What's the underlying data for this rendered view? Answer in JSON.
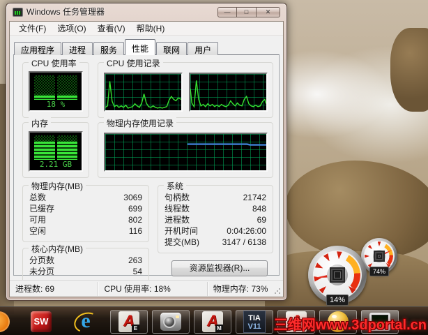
{
  "window": {
    "title": "Windows 任务管理器",
    "menu": [
      "文件(F)",
      "选项(O)",
      "查看(V)",
      "帮助(H)"
    ],
    "caption": {
      "minimize": "—",
      "maximize": "□",
      "close": "✕"
    }
  },
  "tabs": [
    {
      "label": "应用程序",
      "active": false
    },
    {
      "label": "进程",
      "active": false
    },
    {
      "label": "服务",
      "active": false
    },
    {
      "label": "性能",
      "active": true
    },
    {
      "label": "联网",
      "active": false
    },
    {
      "label": "用户",
      "active": false
    }
  ],
  "performance": {
    "cpu_usage": {
      "group_label": "CPU 使用率",
      "value_label": "18 %",
      "percent": 18
    },
    "cpu_history": {
      "group_label": "CPU 使用记录",
      "series": [
        [
          [
            0,
            8
          ],
          [
            3,
            12
          ],
          [
            6,
            80
          ],
          [
            9,
            25
          ],
          [
            12,
            10
          ],
          [
            15,
            14
          ],
          [
            18,
            8
          ],
          [
            21,
            12
          ],
          [
            24,
            8
          ],
          [
            27,
            14
          ],
          [
            30,
            6
          ],
          [
            33,
            8
          ],
          [
            36,
            10
          ],
          [
            39,
            18
          ],
          [
            42,
            12
          ],
          [
            45,
            8
          ],
          [
            48,
            20
          ],
          [
            51,
            45
          ],
          [
            54,
            20
          ],
          [
            57,
            10
          ],
          [
            60,
            8
          ],
          [
            63,
            12
          ],
          [
            66,
            8
          ],
          [
            69,
            6
          ],
          [
            72,
            8
          ],
          [
            75,
            6
          ],
          [
            78,
            8
          ],
          [
            81,
            10
          ],
          [
            84,
            28
          ],
          [
            87,
            38
          ],
          [
            90,
            30
          ],
          [
            93,
            26
          ],
          [
            96,
            34
          ],
          [
            100,
            30
          ]
        ],
        [
          [
            0,
            60
          ],
          [
            2,
            20
          ],
          [
            5,
            10
          ],
          [
            8,
            82
          ],
          [
            11,
            30
          ],
          [
            14,
            12
          ],
          [
            17,
            16
          ],
          [
            20,
            10
          ],
          [
            23,
            18
          ],
          [
            26,
            12
          ],
          [
            29,
            16
          ],
          [
            32,
            10
          ],
          [
            35,
            14
          ],
          [
            38,
            10
          ],
          [
            41,
            16
          ],
          [
            44,
            12
          ],
          [
            47,
            10
          ],
          [
            50,
            14
          ],
          [
            53,
            26
          ],
          [
            56,
            18
          ],
          [
            59,
            12
          ],
          [
            62,
            20
          ],
          [
            65,
            14
          ],
          [
            68,
            12
          ],
          [
            71,
            30
          ],
          [
            74,
            38
          ],
          [
            77,
            18
          ],
          [
            80,
            12
          ],
          [
            83,
            10
          ],
          [
            86,
            14
          ],
          [
            89,
            10
          ],
          [
            92,
            12
          ],
          [
            95,
            24
          ],
          [
            98,
            30
          ],
          [
            100,
            18
          ]
        ]
      ]
    },
    "memory": {
      "group_label": "内存",
      "value_label": "2.21 GB",
      "percent": 73
    },
    "memory_history": {
      "group_label": "物理内存使用记录",
      "series": [
        [
          [
            51,
            72
          ],
          [
            88,
            72
          ],
          [
            90,
            70
          ],
          [
            100,
            70
          ]
        ]
      ]
    },
    "physical_memory": {
      "group_label": "物理内存(MB)",
      "rows": [
        {
          "label": "总数",
          "value": "3069"
        },
        {
          "label": "已缓存",
          "value": "699"
        },
        {
          "label": "可用",
          "value": "802"
        },
        {
          "label": "空闲",
          "value": "116"
        }
      ]
    },
    "kernel_memory": {
      "group_label": "核心内存(MB)",
      "rows": [
        {
          "label": "分页数",
          "value": "263"
        },
        {
          "label": "未分页",
          "value": "54"
        }
      ]
    },
    "system": {
      "group_label": "系统",
      "rows": [
        {
          "label": "句柄数",
          "value": "21742"
        },
        {
          "label": "线程数",
          "value": "848"
        },
        {
          "label": "进程数",
          "value": "69"
        },
        {
          "label": "开机时间",
          "value": "0:04:26:00"
        },
        {
          "label": "提交(MB)",
          "value": "3147 / 6138"
        }
      ]
    },
    "resource_monitor_label": "资源监视器(R)..."
  },
  "status_bar": {
    "processes": "进程数: 69",
    "cpu": "CPU 使用率: 18%",
    "memory": "物理内存: 73%"
  },
  "gadgets": {
    "cpu": {
      "label": "14%",
      "percent": 14
    },
    "ram": {
      "label": "74%",
      "percent": 74
    }
  },
  "taskbar": {
    "items": [
      {
        "name": "hidden-edge-app"
      },
      {
        "name": "solidworks",
        "label": "SW"
      },
      {
        "name": "internet-explorer",
        "label": "e"
      },
      {
        "name": "autocad-electrical",
        "badge": "E"
      },
      {
        "name": "screen-capture"
      },
      {
        "name": "autocad-mechanical",
        "badge": "M"
      },
      {
        "name": "tia-portal",
        "label": "TIA",
        "sub": "V11"
      },
      {
        "name": "autocad",
        "badge": ""
      },
      {
        "name": "gold-app"
      },
      {
        "name": "task-manager"
      }
    ]
  },
  "watermark": "三维网www.3dportal.cn",
  "colors": {
    "led_green": "#39e439",
    "grid_green": "#00aa5a",
    "memory_line_blue": "#3f7fd4",
    "watermark_red": "#ff2b2b"
  }
}
